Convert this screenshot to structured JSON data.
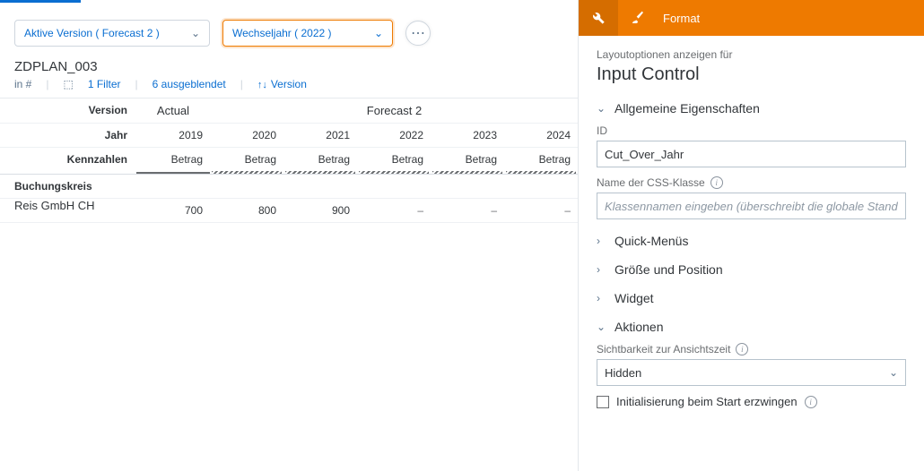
{
  "chips": {
    "active_version": "Aktive Version ( Forecast 2 )",
    "switch_year": "Wechseljahr ( 2022 )"
  },
  "report": {
    "title": "ZDPLAN_003",
    "meta": {
      "in_label": "in #",
      "filter": "1 Filter",
      "hidden": "6 ausgeblendet",
      "version_sort": "Version"
    }
  },
  "grid": {
    "headers": {
      "version": "Version",
      "year": "Jahr",
      "measures": "Kennzahlen"
    },
    "versions": {
      "actual": "Actual",
      "forecast": "Forecast 2"
    },
    "years": [
      "2019",
      "2020",
      "2021",
      "2022",
      "2023",
      "2024"
    ],
    "measure_label": "Betrag",
    "bk_label": "Buchungskreis",
    "rows": [
      {
        "name": "Reis GmbH CH",
        "values": [
          "700",
          "800",
          "900",
          "–",
          "–",
          "–"
        ]
      }
    ]
  },
  "panel": {
    "format_label": "Format",
    "layout_for": "Layoutoptionen anzeigen für",
    "control_title": "Input Control",
    "sections": {
      "general": "Allgemeine Eigenschaften",
      "id_label": "ID",
      "id_value": "Cut_Over_Jahr",
      "css_label": "Name der CSS-Klasse",
      "css_placeholder": "Klassennamen eingeben (überschreibt die globale Stand…",
      "quick": "Quick-Menüs",
      "size": "Größe und Position",
      "widget": "Widget",
      "actions": "Aktionen",
      "visibility_label": "Sichtbarkeit zur Ansichtszeit",
      "visibility_value": "Hidden",
      "init_label": "Initialisierung beim Start erzwingen"
    }
  }
}
